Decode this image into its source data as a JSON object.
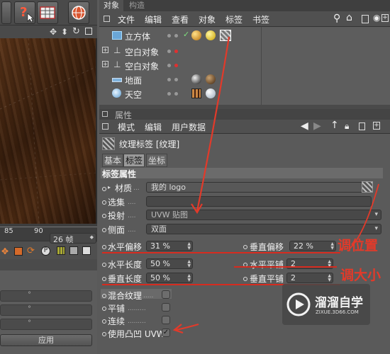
{
  "toolbar_left": {
    "icons": [
      "help-icon",
      "cursor-icon",
      "table-icon",
      "globe-icon"
    ]
  },
  "viewport": {
    "nav_icons": [
      "move-icon",
      "down-arrow-icon",
      "rotate-icon",
      "maximize-icon"
    ]
  },
  "timeline": {
    "ticks": [
      "85",
      "90"
    ],
    "frame": "26 帧"
  },
  "left_panel": {
    "apply_label": "应用",
    "field_marker": "°"
  },
  "object_manager": {
    "tabs": [
      "对象",
      "构造"
    ],
    "menu": [
      "文件",
      "编辑",
      "查看",
      "对象",
      "标签",
      "书签"
    ],
    "objects": [
      {
        "name": "立方体",
        "check": "✓"
      },
      {
        "name": "空白对象"
      },
      {
        "name": "空白对象"
      },
      {
        "name": "地面"
      },
      {
        "name": "天空"
      }
    ]
  },
  "attribute_manager": {
    "title": "属性",
    "menu": [
      "模式",
      "编辑",
      "用户数据"
    ],
    "tag_title": "纹理标签 [纹理]",
    "subtabs": [
      "基本",
      "标签",
      "坐标"
    ],
    "section": "标签属性",
    "material_label": "材质",
    "material_value": "我的 logo",
    "selection_label": "选集",
    "projection_label": "投射",
    "projection_value": "UVW 贴图",
    "side_label": "侧面",
    "side_value": "双面",
    "offset_u_label": "水平偏移",
    "offset_u_value": "31 %",
    "offset_v_label": "垂直偏移",
    "offset_v_value": "22 %",
    "length_u_label": "水平长度",
    "length_u_value": "50 %",
    "tiles_u_label": "水平平铺",
    "tiles_u_value": "2",
    "length_v_label": "垂直长度",
    "length_v_value": "50 %",
    "tiles_v_label": "垂直平铺",
    "tiles_v_value": "2",
    "mix_label": "混合纹理",
    "tile_label": "平铺",
    "seamless_label": "连续",
    "bump_label": "使用凸凹 UVW",
    "bump_check": "✓"
  },
  "annotations": {
    "position": "调位置",
    "size": "调大小"
  },
  "watermark": {
    "title": "溜溜自学",
    "url": "ZIXUE.3D66.COM"
  },
  "colors": {
    "annotation": "#e23a2a",
    "panel": "#5a5a5a"
  }
}
